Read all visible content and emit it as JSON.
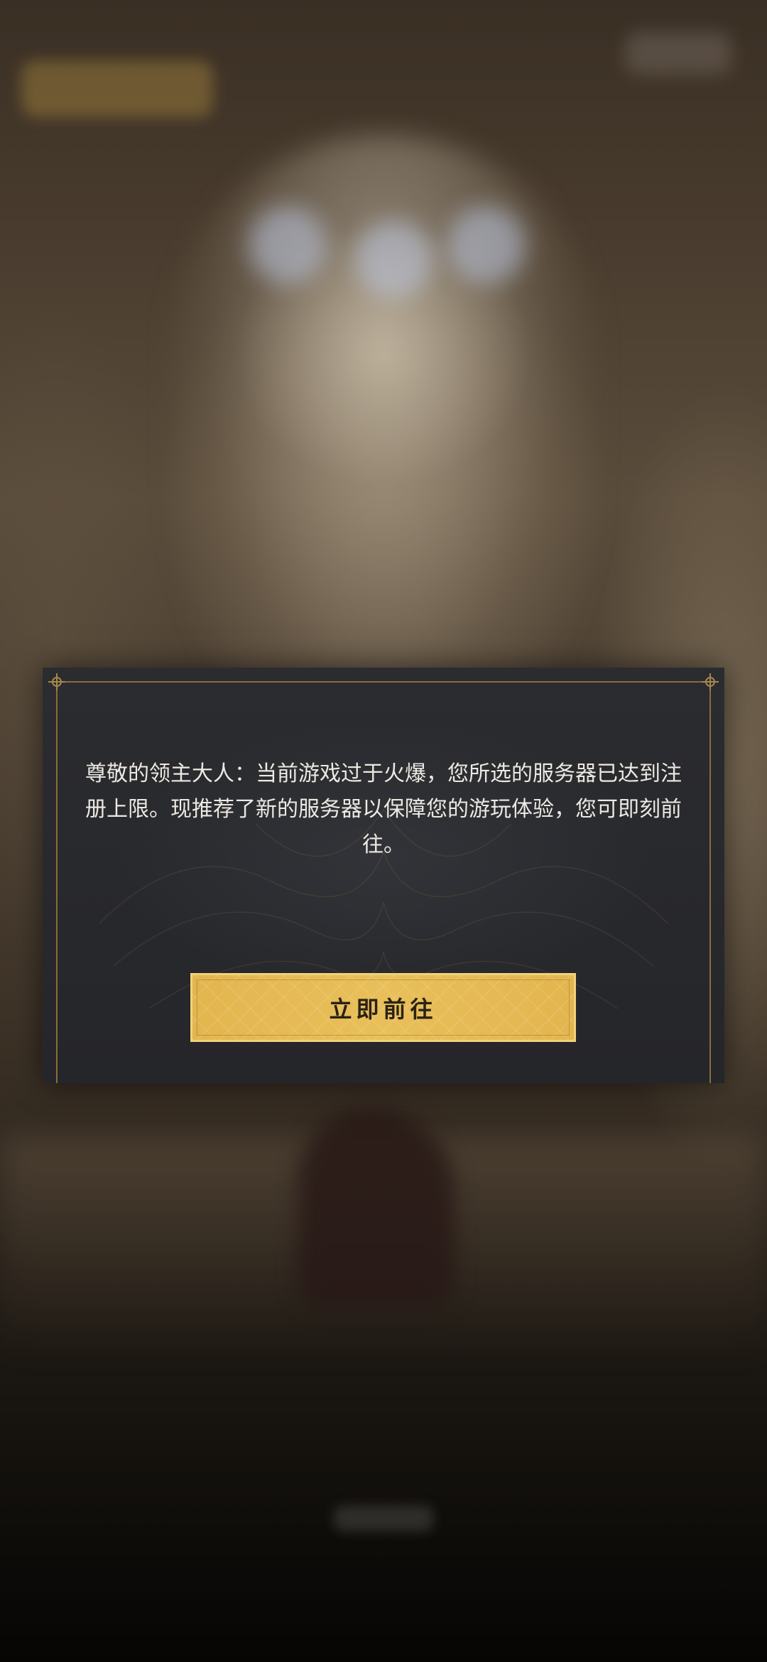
{
  "dialog": {
    "message": "尊敬的领主大人：当前游戏过于火爆，您所选的服务器已达到注册上限。现推荐了新的服务器以保障您的游玩体验，您可即刻前往。",
    "confirm_label": "立即前往"
  },
  "colors": {
    "dialog_background": "#2b2c30",
    "accent_gold": "#e3b54f",
    "frame_gold": "#8a6e38",
    "message_text": "#ece9e2"
  }
}
